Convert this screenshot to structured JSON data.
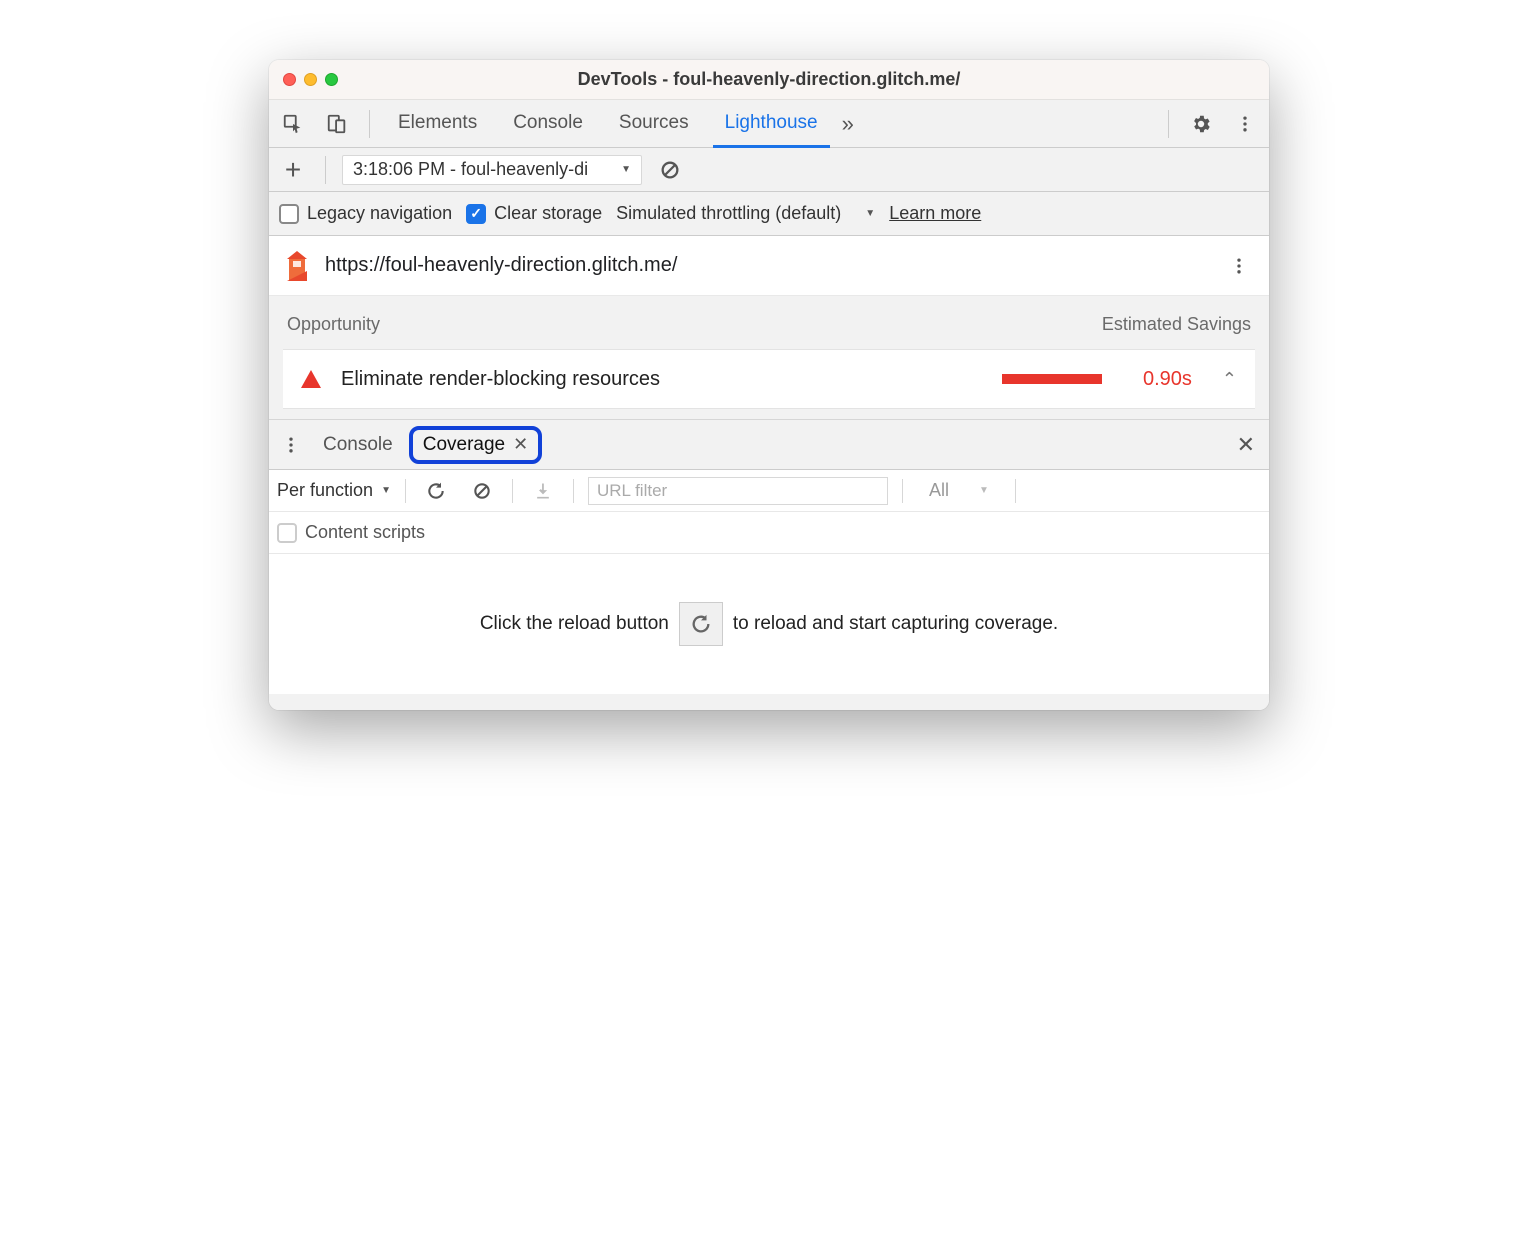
{
  "window": {
    "title": "DevTools - foul-heavenly-direction.glitch.me/"
  },
  "tabs": [
    "Elements",
    "Console",
    "Sources",
    "Lighthouse"
  ],
  "activeTab": "Lighthouse",
  "lh_toolbar": {
    "report_select": "3:18:06 PM - foul-heavenly-di"
  },
  "lh_options": {
    "legacy_label": "Legacy navigation",
    "clear_label": "Clear storage",
    "throttling_label": "Simulated throttling (default)",
    "learn_more": "Learn more"
  },
  "lh_url": "https://foul-heavenly-direction.glitch.me/",
  "opportunity": {
    "header_left": "Opportunity",
    "header_right": "Estimated Savings",
    "title": "Eliminate render-blocking resources",
    "time": "0.90s"
  },
  "drawer": {
    "console_tab": "Console",
    "coverage_tab": "Coverage"
  },
  "coverage": {
    "granularity": "Per function",
    "url_filter_placeholder": "URL filter",
    "type_filter": "All",
    "content_scripts_label": "Content scripts",
    "hint_prefix": "Click the reload button",
    "hint_suffix": "to reload and start capturing coverage."
  }
}
